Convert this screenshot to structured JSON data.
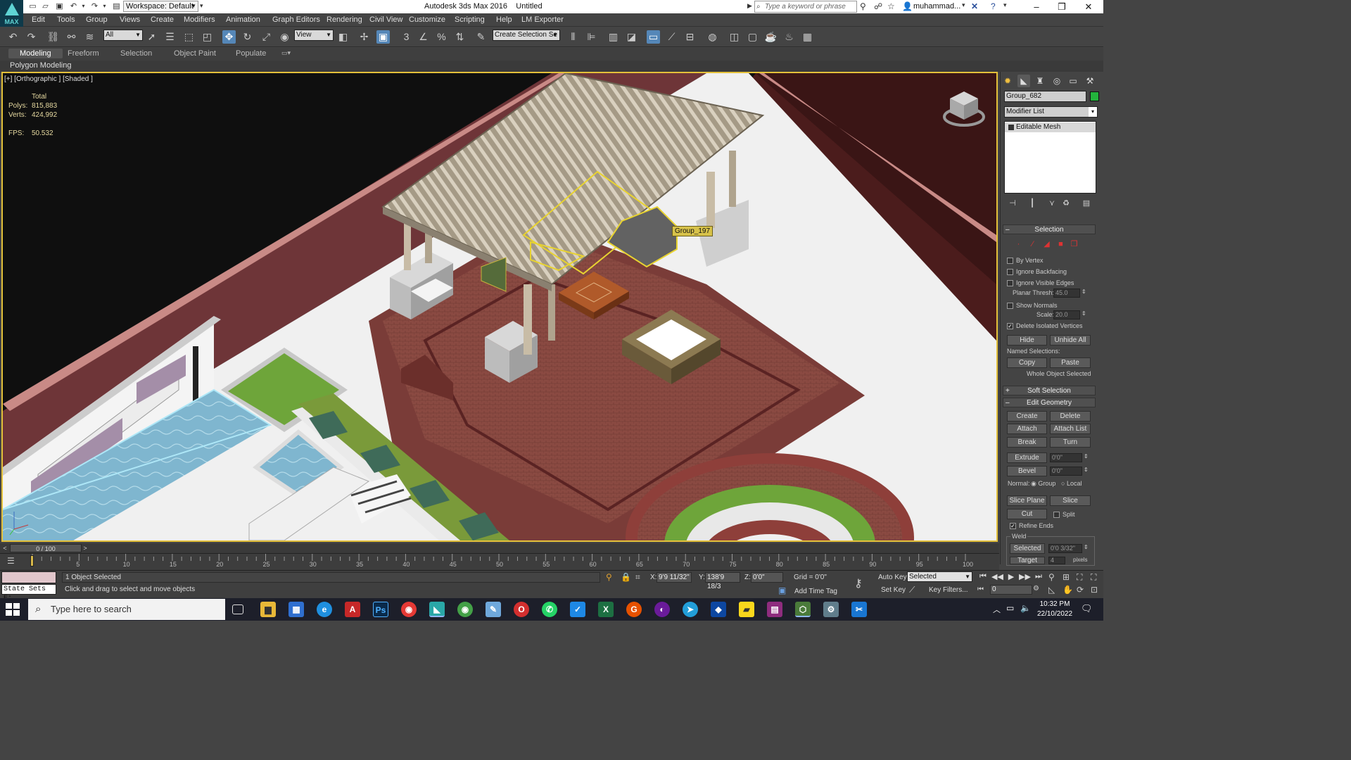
{
  "titlebar": {
    "logo_text": "MAX",
    "workspace": "Workspace: Default",
    "app_title": "Autodesk 3ds Max 2016",
    "doc_title": "Untitled",
    "search_placeholder": "Type a keyword or phrase",
    "user": "muhammad..."
  },
  "menu": [
    "Edit",
    "Tools",
    "Group",
    "Views",
    "Create",
    "Modifiers",
    "Animation",
    "Graph Editors",
    "Rendering",
    "Civil View",
    "Customize",
    "Scripting",
    "Help",
    "LM Exporter"
  ],
  "toolbar": {
    "filter_combo": "All",
    "ref_coord_combo": "View",
    "named_sel_combo": "Create Selection Se",
    "snap_label": "3"
  },
  "ribbon": {
    "tabs": [
      "Modeling",
      "Freeform",
      "Selection",
      "Object Paint",
      "Populate"
    ],
    "active_tab": "Modeling",
    "subpanel": "Polygon Modeling"
  },
  "viewport": {
    "label": "[+] [Orthographic ] [Shaded ]",
    "stats": {
      "total_label": "Total",
      "polys_label": "Polys:",
      "polys": "815,883",
      "verts_label": "Verts:",
      "verts": "424,992",
      "fps_label": "FPS:",
      "fps": "50.532"
    },
    "selected_tag": "Group_197"
  },
  "command_panel": {
    "object_name": "Group_682",
    "object_color": "#23b33c",
    "modifier_list": "Modifier List",
    "stack_item": "Editable Mesh",
    "selection_rollout": "Selection",
    "by_vertex": "By Vertex",
    "ignore_backfacing": "Ignore Backfacing",
    "ignore_visible_edges": "Ignore Visible Edges",
    "planar_thresh_label": "Planar Thresh:",
    "planar_thresh": "45.0",
    "show_normals": "Show Normals",
    "scale_label": "Scale:",
    "scale": "20.0",
    "delete_isolated": "Delete Isolated Vertices",
    "hide": "Hide",
    "unhide_all": "Unhide All",
    "named_selections": "Named Selections:",
    "copy": "Copy",
    "paste": "Paste",
    "whole_object": "Whole Object Selected",
    "soft_selection": "Soft Selection",
    "edit_geometry": "Edit Geometry",
    "create": "Create",
    "delete": "Delete",
    "attach": "Attach",
    "attach_list": "Attach List",
    "break": "Break",
    "turn": "Turn",
    "extrude": "Extrude",
    "extrude_val": "0'0\"",
    "bevel": "Bevel",
    "bevel_val": "0'0\"",
    "normal_label": "Normal:",
    "group": "Group",
    "local": "Local",
    "slice_plane": "Slice Plane",
    "slice": "Slice",
    "cut": "Cut",
    "split": "Split",
    "refine_ends": "Refine Ends",
    "weld": "Weld",
    "selected": "Selected",
    "selected_val": "0'0 3/32\"",
    "target": "Target",
    "target_val": "4",
    "pixels": "pixels"
  },
  "timeline": {
    "frame": "0 / 100",
    "ticks": [
      "5",
      "10",
      "15",
      "20",
      "25",
      "30",
      "35",
      "40",
      "45",
      "50",
      "55",
      "60",
      "65",
      "70",
      "75",
      "80",
      "85",
      "90",
      "95",
      "100"
    ]
  },
  "status": {
    "state_sets": "State Sets E:",
    "selection_info": "1 Object Selected",
    "prompt": "Click and drag to select and move objects",
    "x_label": "X:",
    "x": "9'9 11/32\"",
    "y_label": "Y:",
    "y": "138'9 18/3",
    "z_label": "Z:",
    "z": "0'0\"",
    "grid": "Grid = 0'0\"",
    "add_time_tag": "Add Time Tag",
    "auto_key": "Auto Key",
    "set_key": "Set Key",
    "key_mode": "Selected",
    "key_filters": "Key Filters...",
    "current_frame": "0"
  },
  "taskbar": {
    "search_placeholder": "Type here to search",
    "time": "10:32 PM",
    "date": "22/10/2022",
    "apps": [
      "task-view",
      "file-explorer",
      "calculator",
      "edge",
      "acrobat",
      "photoshop",
      "chrome",
      "3dsmax",
      "chrome-alt",
      "notepad",
      "opera",
      "whatsapp",
      "todo",
      "excel",
      "grammarly",
      "podcast",
      "telegram",
      "cube-app",
      "sticky-notes",
      "winrar",
      "sketchup",
      "settings",
      "snipping"
    ]
  }
}
